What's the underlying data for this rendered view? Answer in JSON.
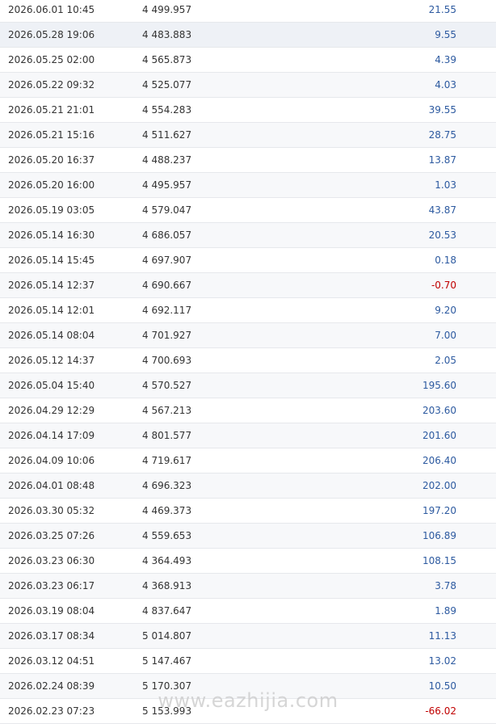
{
  "rows": [
    {
      "time": "2026.06.01 10:45",
      "price": "4 499.957",
      "profit": "21.55",
      "negative": false
    },
    {
      "time": "2026.05.28 19:06",
      "price": "4 483.883",
      "profit": "9.55",
      "negative": false
    },
    {
      "time": "2026.05.25 02:00",
      "price": "4 565.873",
      "profit": "4.39",
      "negative": false
    },
    {
      "time": "2026.05.22 09:32",
      "price": "4 525.077",
      "profit": "4.03",
      "negative": false
    },
    {
      "time": "2026.05.21 21:01",
      "price": "4 554.283",
      "profit": "39.55",
      "negative": false
    },
    {
      "time": "2026.05.21 15:16",
      "price": "4 511.627",
      "profit": "28.75",
      "negative": false
    },
    {
      "time": "2026.05.20 16:37",
      "price": "4 488.237",
      "profit": "13.87",
      "negative": false
    },
    {
      "time": "2026.05.20 16:00",
      "price": "4 495.957",
      "profit": "1.03",
      "negative": false
    },
    {
      "time": "2026.05.19 03:05",
      "price": "4 579.047",
      "profit": "43.87",
      "negative": false
    },
    {
      "time": "2026.05.14 16:30",
      "price": "4 686.057",
      "profit": "20.53",
      "negative": false
    },
    {
      "time": "2026.05.14 15:45",
      "price": "4 697.907",
      "profit": "0.18",
      "negative": false
    },
    {
      "time": "2026.05.14 12:37",
      "price": "4 690.667",
      "profit": "-0.70",
      "negative": true
    },
    {
      "time": "2026.05.14 12:01",
      "price": "4 692.117",
      "profit": "9.20",
      "negative": false
    },
    {
      "time": "2026.05.14 08:04",
      "price": "4 701.927",
      "profit": "7.00",
      "negative": false
    },
    {
      "time": "2026.05.12 14:37",
      "price": "4 700.693",
      "profit": "2.05",
      "negative": false
    },
    {
      "time": "2026.05.04 15:40",
      "price": "4 570.527",
      "profit": "195.60",
      "negative": false
    },
    {
      "time": "2026.04.29 12:29",
      "price": "4 567.213",
      "profit": "203.60",
      "negative": false
    },
    {
      "time": "2026.04.14 17:09",
      "price": "4 801.577",
      "profit": "201.60",
      "negative": false
    },
    {
      "time": "2026.04.09 10:06",
      "price": "4 719.617",
      "profit": "206.40",
      "negative": false
    },
    {
      "time": "2026.04.01 08:48",
      "price": "4 696.323",
      "profit": "202.00",
      "negative": false
    },
    {
      "time": "2026.03.30 05:32",
      "price": "4 469.373",
      "profit": "197.20",
      "negative": false
    },
    {
      "time": "2026.03.25 07:26",
      "price": "4 559.653",
      "profit": "106.89",
      "negative": false
    },
    {
      "time": "2026.03.23 06:30",
      "price": "4 364.493",
      "profit": "108.15",
      "negative": false
    },
    {
      "time": "2026.03.23 06:17",
      "price": "4 368.913",
      "profit": "3.78",
      "negative": false
    },
    {
      "time": "2026.03.19 08:04",
      "price": "4 837.647",
      "profit": "1.89",
      "negative": false
    },
    {
      "time": "2026.03.17 08:34",
      "price": "5 014.807",
      "profit": "11.13",
      "negative": false
    },
    {
      "time": "2026.03.12 04:51",
      "price": "5 147.467",
      "profit": "13.02",
      "negative": false
    },
    {
      "time": "2026.02.24 08:39",
      "price": "5 170.307",
      "profit": "10.50",
      "negative": false
    },
    {
      "time": "2026.02.23 07:23",
      "price": "5 153.993",
      "profit": "-66.02",
      "negative": true
    }
  ],
  "watermark": "www.eazhijia.com"
}
